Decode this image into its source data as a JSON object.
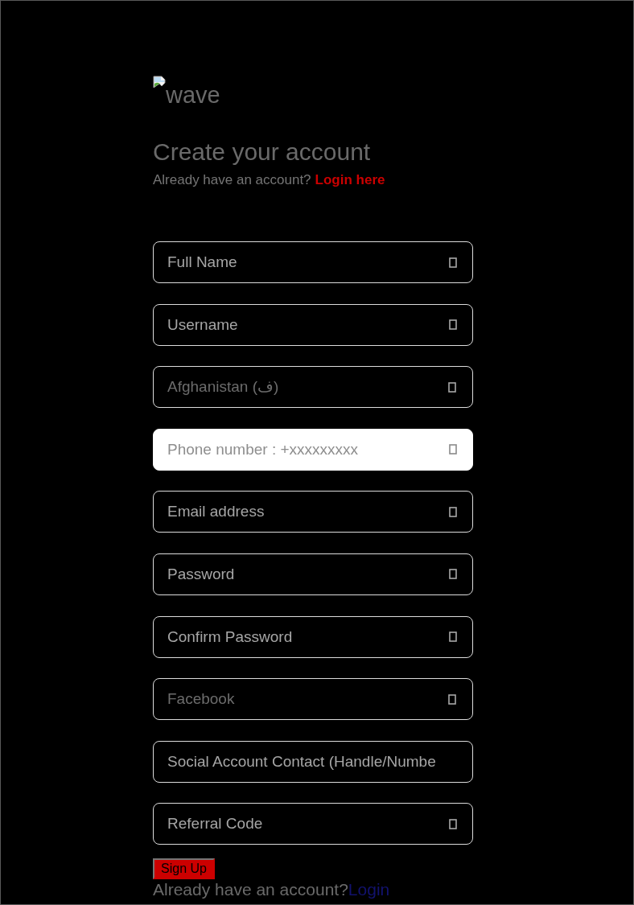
{
  "logo": {
    "alt_text": "wave"
  },
  "heading": {
    "title": "Create your account",
    "prompt": "Already have an account?",
    "link": "Login here"
  },
  "fields": [
    {
      "kind": "text",
      "placeholder": "Full Name",
      "trailing_icon": true
    },
    {
      "kind": "text",
      "placeholder": "Username",
      "trailing_icon": true
    },
    {
      "kind": "select",
      "value": "Afghanistan (ف)",
      "trailing_icon": true
    },
    {
      "kind": "phone",
      "placeholder": "Phone number : +xxxxxxxxx",
      "trailing_icon": true
    },
    {
      "kind": "text",
      "placeholder": "Email address",
      "trailing_icon": true
    },
    {
      "kind": "text",
      "placeholder": "Password",
      "trailing_icon": true
    },
    {
      "kind": "text",
      "placeholder": "Confirm Password",
      "trailing_icon": true
    },
    {
      "kind": "select",
      "value": "Facebook",
      "trailing_icon": true
    },
    {
      "kind": "text",
      "placeholder": "Social Account Contact (Handle/Numbe",
      "trailing_icon": false
    },
    {
      "kind": "text",
      "placeholder": "Referral Code",
      "trailing_icon": true
    }
  ],
  "submit": {
    "label": "Sign Up"
  },
  "footer": {
    "prompt": "Already have an account?",
    "link": "Login"
  }
}
